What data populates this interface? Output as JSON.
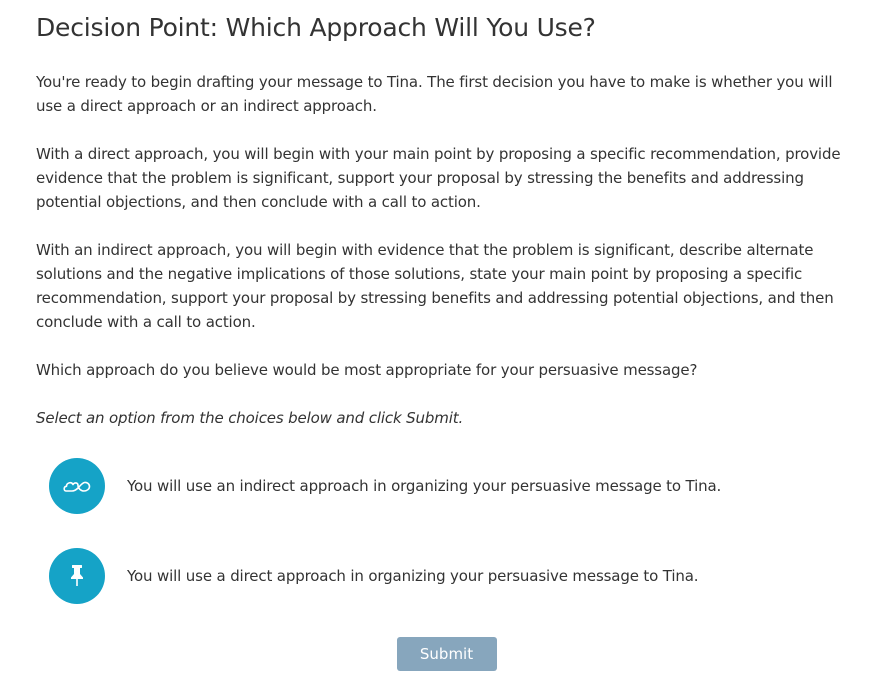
{
  "title": "Decision Point: Which Approach Will You Use?",
  "paragraphs": [
    "You're ready to begin drafting your message to Tina. The first decision you have to make is whether you will use a direct approach or an indirect approach.",
    "With a direct approach, you will begin with your main point by proposing a specific recommendation, provide evidence that the problem is significant, support your proposal by stressing the benefits and addressing potential objections, and then conclude with a call to action.",
    "With an indirect approach, you will begin with evidence that the problem is significant, describe alternate solutions and the negative implications of those solutions, state your main point by proposing a specific recommendation, support your proposal by stressing benefits and addressing potential objections, and then conclude with a call to action.",
    "Which approach do you believe would be most appropriate for your persuasive message?"
  ],
  "instruction": "Select an option from the choices below and click Submit.",
  "options": [
    {
      "icon": "infinity-cloud-icon",
      "label": "You will use an indirect approach in organizing your persuasive message to Tina."
    },
    {
      "icon": "pushpin-icon",
      "label": "You will use a direct approach in organizing your persuasive message to Tina."
    }
  ],
  "submit_label": "Submit",
  "colors": {
    "icon_circle": "#15a3c7",
    "submit_button": "#87a6bd",
    "text": "#333333"
  }
}
